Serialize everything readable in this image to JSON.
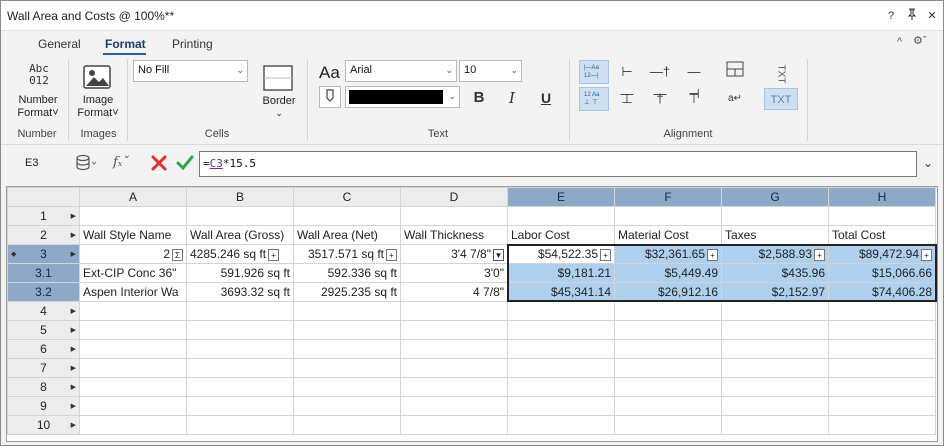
{
  "window": {
    "title": "Wall Area and Costs @ 100%**",
    "controls": {
      "help": "?",
      "pin": "↕",
      "close": "✕"
    }
  },
  "ribbon": {
    "tabs": [
      {
        "label": "General"
      },
      {
        "label": "Format"
      },
      {
        "label": "Printing"
      }
    ],
    "number": {
      "icon_text": "Abc\n012",
      "label1": "Number",
      "label2": "Format˅",
      "group": "Number"
    },
    "images": {
      "label1": "Image",
      "label2": "Format˅",
      "group": "Images"
    },
    "cells": {
      "fill_value": "No Fill",
      "border_label": "Border",
      "group": "Cells"
    },
    "text": {
      "font_icon": "Aa",
      "font_value": "Arial",
      "size_value": "10",
      "bold": "B",
      "italic": "I",
      "underline": "U",
      "group": "Text"
    },
    "alignment": {
      "group": "Alignment",
      "txt_vertical": "TXT",
      "txt_horizontal": "TXT"
    }
  },
  "formula_bar": {
    "cell_ref": "E3",
    "prefix": "=",
    "ref": "C3",
    "suffix": "*15.5"
  },
  "grid": {
    "columns": [
      "A",
      "B",
      "C",
      "D",
      "E",
      "F",
      "G",
      "H"
    ],
    "rows": [
      {
        "label": "1",
        "cells": [
          "",
          "",
          "",
          "",
          "",
          "",
          "",
          ""
        ]
      },
      {
        "label": "2",
        "cells": [
          "Wall Style Name",
          "Wall Area (Gross)",
          "Wall Area (Net)",
          "Wall Thickness",
          "Labor Cost",
          "Material Cost",
          "Taxes",
          "Total Cost"
        ]
      },
      {
        "label": "3",
        "cells": [
          "2",
          "4285.246 sq ft",
          "3517.571 sq ft",
          "3'4 7/8\"",
          "$54,522.35",
          "$32,361.65",
          "$2,588.93",
          "$89,472.94"
        ]
      },
      {
        "label": "3.1",
        "cells": [
          "Ext-CIP Conc 36\"",
          "591.926 sq ft",
          "592.336 sq ft",
          "3'0\"",
          "$9,181.21",
          "$5,449.49",
          "$435.96",
          "$15,066.66"
        ]
      },
      {
        "label": "3.2",
        "cells": [
          "Aspen Interior Wa",
          "3693.32 sq ft",
          "2925.235 sq ft",
          "4 7/8\"",
          "$45,341.14",
          "$26,912.16",
          "$2,152.97",
          "$74,406.28"
        ]
      },
      {
        "label": "4",
        "cells": [
          "",
          "",
          "",
          "",
          "",
          "",
          "",
          ""
        ]
      },
      {
        "label": "5",
        "cells": [
          "",
          "",
          "",
          "",
          "",
          "",
          "",
          ""
        ]
      },
      {
        "label": "6",
        "cells": [
          "",
          "",
          "",
          "",
          "",
          "",
          "",
          ""
        ]
      },
      {
        "label": "7",
        "cells": [
          "",
          "",
          "",
          "",
          "",
          "",
          "",
          ""
        ]
      },
      {
        "label": "8",
        "cells": [
          "",
          "",
          "",
          "",
          "",
          "",
          "",
          ""
        ]
      },
      {
        "label": "9",
        "cells": [
          "",
          "",
          "",
          "",
          "",
          "",
          "",
          ""
        ]
      },
      {
        "label": "10",
        "cells": [
          "",
          "",
          "",
          "",
          "",
          "",
          "",
          ""
        ]
      }
    ]
  }
}
